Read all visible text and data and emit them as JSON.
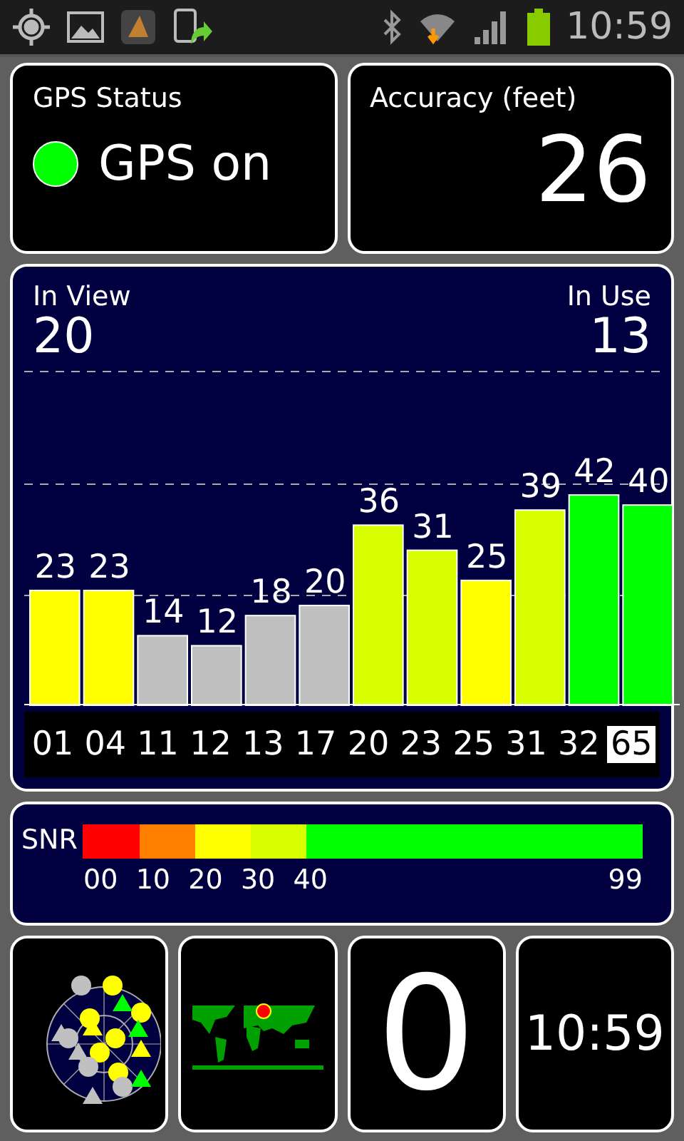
{
  "status_bar": {
    "time": "10:59"
  },
  "gps_status": {
    "title": "GPS Status",
    "on": true,
    "text": "GPS on"
  },
  "accuracy": {
    "title": "Accuracy (feet)",
    "value": "26"
  },
  "satellites_panel": {
    "in_view_label": "In View",
    "in_view": "20",
    "in_use_label": "In Use",
    "in_use": "13",
    "satellites": [
      {
        "in_use": true,
        "selected": false
      },
      {
        "in_use": true,
        "selected": false
      },
      {
        "in_use": false,
        "selected": false
      },
      {
        "in_use": false,
        "selected": false
      },
      {
        "in_use": false,
        "selected": false
      },
      {
        "in_use": false,
        "selected": false
      },
      {
        "in_use": true,
        "selected": false
      },
      {
        "in_use": true,
        "selected": false
      },
      {
        "in_use": true,
        "selected": false
      },
      {
        "in_use": true,
        "selected": false
      },
      {
        "in_use": true,
        "selected": false
      },
      {
        "in_use": true,
        "selected": true
      }
    ],
    "chart_data": {
      "type": "bar",
      "categories": [
        "01",
        "04",
        "11",
        "12",
        "13",
        "17",
        "20",
        "23",
        "25",
        "31",
        "32",
        "65"
      ],
      "ylim": [
        0,
        67
      ],
      "data_labels": true,
      "values": [
        23,
        23,
        14,
        12,
        18,
        20,
        36,
        31,
        25,
        39,
        42,
        40
      ]
    }
  },
  "snr_scale": {
    "label": "SNR",
    "end_label": "99",
    "segments": [
      {
        "label": "00",
        "color": "#ff0000"
      },
      {
        "label": "10",
        "color": "#ff8000"
      },
      {
        "label": "20",
        "color": "#ffff00"
      },
      {
        "label": "30",
        "color": "#d8ff00"
      },
      {
        "label": "40",
        "color": "#00ff00"
      }
    ]
  },
  "tiles": [
    {
      "kind": "skyplot"
    },
    {
      "kind": "map"
    },
    {
      "kind": "text",
      "text": "0"
    },
    {
      "kind": "text",
      "text": "10:59"
    }
  ]
}
